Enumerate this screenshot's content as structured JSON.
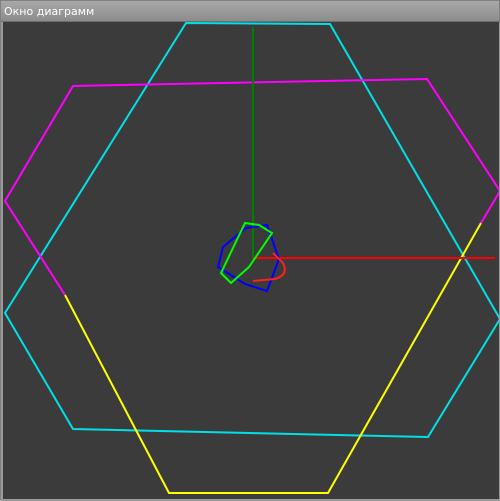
{
  "window": {
    "title": "Окно диаграмм"
  },
  "diagram": {
    "background": "#3b3b3b",
    "axes": {
      "x_color": "#ff0000",
      "y_color": "#008000"
    },
    "shapes": [
      {
        "name": "large-hexagon-cyan",
        "color": "#00e0e8"
      },
      {
        "name": "large-hexagon-magenta-yellow",
        "colors": [
          "#ff00ff",
          "#ffff00"
        ]
      },
      {
        "name": "small-hexagon-blue",
        "color": "#0000ff"
      },
      {
        "name": "small-triangle-green",
        "color": "#00ff00"
      },
      {
        "name": "small-arc-red",
        "color": "#ff2020"
      }
    ]
  }
}
